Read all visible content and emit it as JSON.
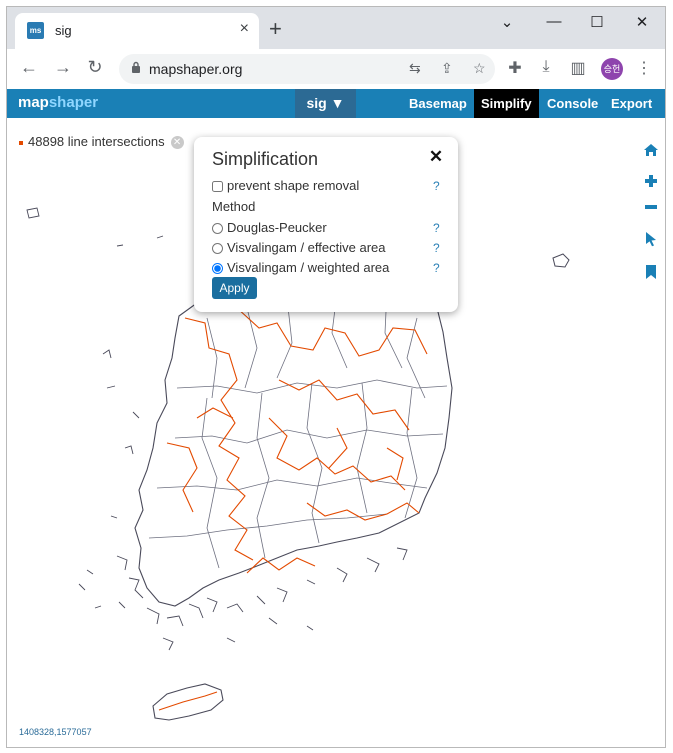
{
  "browser": {
    "tab": {
      "title": "sig",
      "favicon": "ms",
      "close_icon": "close-icon"
    },
    "new_tab_label": "+",
    "window": {
      "minimize": "⌄",
      "restore": "—",
      "maximize": "☐",
      "close": "✕"
    },
    "nav": {
      "back": "←",
      "forward": "→",
      "reload": "↻"
    },
    "address": {
      "url": "mapshaper.org"
    },
    "toolbar_icons": [
      "translate-icon",
      "share-icon",
      "star-icon",
      "extensions-icon",
      "download-icon",
      "sidepanel-icon",
      "menu-icon"
    ],
    "profile_label": "승헌"
  },
  "app": {
    "logo_part1": "map",
    "logo_part2": "shaper",
    "layer_label": "sig ▼",
    "menu": [
      {
        "label": "Basemap",
        "active": false
      },
      {
        "label": "Simplify",
        "active": true
      },
      {
        "label": "Console",
        "active": false
      },
      {
        "label": "Export",
        "active": false
      }
    ],
    "accent": "#1a80b6",
    "intersections_label": "48898 line intersections",
    "intersection_color": "#e34a00",
    "coordinates": "1408328,1577057",
    "map_tools": [
      "home-icon",
      "zoom-in-icon",
      "zoom-out-icon",
      "pointer-icon",
      "bookmark-icon"
    ]
  },
  "simplification": {
    "title": "Simplification",
    "close": "✕",
    "prevent_removal_label": "prevent shape removal",
    "prevent_removal_checked": false,
    "method_heading": "Method",
    "methods": [
      {
        "label": "Douglas-Peucker",
        "selected": false
      },
      {
        "label": "Visvalingam / effective area",
        "selected": false
      },
      {
        "label": "Visvalingam / weighted area",
        "selected": true
      }
    ],
    "help_label": "?",
    "apply_label": "Apply"
  }
}
